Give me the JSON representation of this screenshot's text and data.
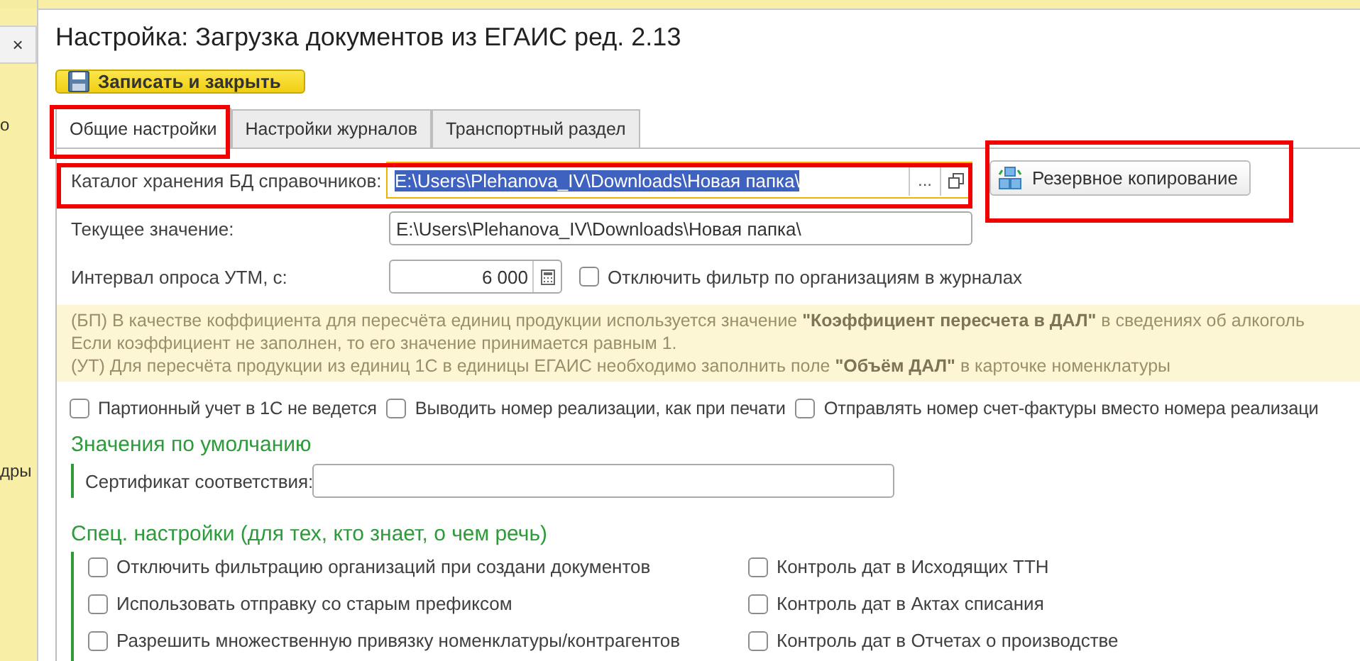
{
  "background_window": {
    "close_tab": "×",
    "side_fragments": [
      "о",
      "дры"
    ]
  },
  "window": {
    "title": "Настройка: Загрузка документов из ЕГАИС ред. 2.13"
  },
  "toolbar": {
    "save_button": "Записать и закрыть"
  },
  "tabs": [
    {
      "label": "Общие настройки",
      "selected": true
    },
    {
      "label": "Настройки журналов",
      "selected": false
    },
    {
      "label": "Транспортный раздел",
      "selected": false
    }
  ],
  "catalog_field": {
    "label": "Каталог хранения БД справочников:",
    "value": "E:\\Users\\Plehanova_IV\\Downloads\\Новая папка\\",
    "text_selected": true,
    "focused": true,
    "choose_button": "..."
  },
  "backup_button": "Резервное копирование",
  "current_value": {
    "label": "Текущее значение:",
    "value": "E:\\Users\\Plehanova_IV\\Downloads\\Новая папка\\"
  },
  "poll_interval": {
    "label": "Интервал опроса УТМ, с:",
    "value": "6 000"
  },
  "filter_checkbox": {
    "label": "Отключить фильтр по организациям в журналах",
    "checked": false
  },
  "note_lines": [
    "(БП) В качестве коффициента для пересчёта единиц продукции используется значение **\"Коэффициент пересчета в ДАЛ\"** в сведениях об алкоголь",
    "Если коэффициент не заполнен, то его значение принимается равным 1.",
    "(УТ) Для пересчёта продукции из единиц 1С в единицы ЕГАИС необходимо заполнить поле **\"Объём ДАЛ\"** в карточке номенклатуры"
  ],
  "options": [
    {
      "label": "Партионный учет в 1С не ведется",
      "checked": false
    },
    {
      "label": "Выводить номер реализации, как при печати",
      "checked": false
    },
    {
      "label": "Отправлять номер счет-фактуры вместо номера реализаци",
      "checked": false
    }
  ],
  "defaults_section": {
    "title": "Значения по умолчанию",
    "certificate_label": "Сертификат соответствия:"
  },
  "special_section": {
    "title": "Спец. настройки (для тех, кто знает, о чем речь)",
    "left": [
      {
        "label": "Отключить фильтрацию организаций при создани документов",
        "checked": false
      },
      {
        "label": "Использовать отправку со старым префиксом",
        "checked": false
      },
      {
        "label": "Разрешить множественную привязку номенклатуры/контрагентов",
        "checked": false
      }
    ],
    "right": [
      {
        "label": "Контроль дат в Исходящих ТТН",
        "checked": false
      },
      {
        "label": "Контроль дат в Актах списания",
        "checked": false
      },
      {
        "label": "Контроль дат в Отчетах о производстве",
        "checked": false
      }
    ]
  }
}
